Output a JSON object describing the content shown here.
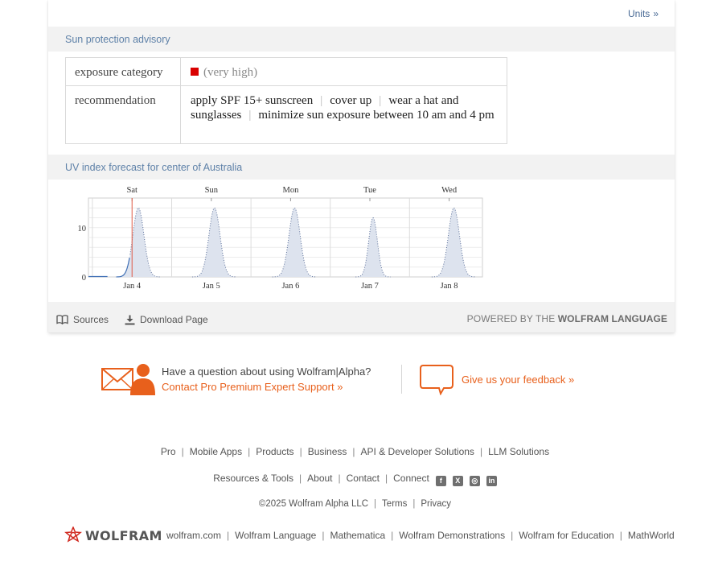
{
  "card": {
    "units_link": {
      "label": "Units",
      "chevron": "»"
    },
    "sun_protection": {
      "title": "Sun protection advisory",
      "rows": {
        "exposure_label": "exposure category",
        "exposure_value": "(very high)",
        "exposure_color": "#d90000",
        "recommendation_label": "recommendation",
        "recommendations": [
          "apply SPF 15+ sunscreen",
          "cover up",
          "wear a hat and sunglasses",
          "minimize sun exposure between 10 am and 4 pm"
        ],
        "separator": "|"
      }
    },
    "uv_forecast": {
      "title": "UV index forecast for center of Australia"
    },
    "footer": {
      "sources_label": "Sources",
      "download_label": "Download Page",
      "powered_prefix": "POWERED BY THE",
      "powered_brand": "WOLFRAM LANGUAGE"
    }
  },
  "chart_data": {
    "type": "area",
    "title": "",
    "xlabel": "",
    "ylabel": "",
    "top_tick_labels": [
      "Sat",
      "Sun",
      "Mon",
      "Tue",
      "Wed"
    ],
    "bottom_tick_labels": [
      "Jan 4",
      "Jan 5",
      "Jan 6",
      "Jan 7",
      "Jan 8"
    ],
    "y_ticks": [
      0,
      10
    ],
    "ylim": [
      0,
      16
    ],
    "xlim_days": [
      -0.55,
      4.42
    ],
    "current_time_day": 0.0,
    "now_marker_color": "#e05a45",
    "series": [
      {
        "name": "",
        "peak_day": 0.08,
        "peak_uv": 14.0,
        "width_day": 0.07
      },
      {
        "name": "",
        "peak_day": 1.04,
        "peak_uv": 14.0,
        "width_day": 0.07
      },
      {
        "name": "",
        "peak_day": 2.05,
        "peak_uv": 14.0,
        "width_day": 0.07
      },
      {
        "name": "",
        "peak_day": 3.04,
        "peak_uv": 12.0,
        "width_day": 0.055
      },
      {
        "name": "",
        "peak_day": 4.06,
        "peak_uv": 14.0,
        "width_day": 0.07
      }
    ],
    "observed_until_day": -0.03,
    "grid": true,
    "colors": {
      "fill": "#dde3ee",
      "observed_line": "#3f6fb5",
      "forecast_dots": "#5b6f99"
    }
  },
  "support": {
    "question": "Have a question about using Wolfram|Alpha?",
    "link": "Contact Pro Premium Expert Support »"
  },
  "feedback": {
    "link": "Give us your feedback »"
  },
  "footer_links": {
    "row1": [
      "Pro",
      "Mobile Apps",
      "Products",
      "Business",
      "API & Developer Solutions",
      "LLM Solutions"
    ],
    "row2": [
      "Resources & Tools",
      "About",
      "Contact",
      "Connect"
    ],
    "social": [
      "facebook-icon",
      "x-icon",
      "instagram-icon",
      "linkedin-icon"
    ],
    "row3": [
      "©2025  Wolfram Alpha LLC",
      "Terms",
      "Privacy"
    ],
    "separator": "|"
  },
  "bottom": {
    "logo_text": "WOLFRAM",
    "links": [
      "wolfram.com",
      "Wolfram Language",
      "Mathematica",
      "Wolfram Demonstrations",
      "Wolfram for Education",
      "MathWorld"
    ]
  },
  "accent": "#e8601c"
}
